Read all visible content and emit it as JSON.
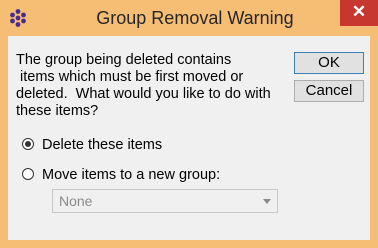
{
  "window": {
    "title": "Group Removal Warning",
    "close_label": "✕",
    "app_icon": "cluster-dots-icon",
    "accent_color": "#f6be74",
    "close_color": "#c7372f"
  },
  "message": {
    "lines": [
      "The group being deleted contains",
      " items which must be first moved or",
      "deleted.  What would you like to do with",
      "these items?"
    ]
  },
  "buttons": {
    "ok_label": "OK",
    "cancel_label": "Cancel"
  },
  "options": {
    "delete_label": "Delete these items",
    "move_label": "Move items to a new group:",
    "selected": "delete"
  },
  "group_select": {
    "value": "None",
    "enabled": false
  }
}
